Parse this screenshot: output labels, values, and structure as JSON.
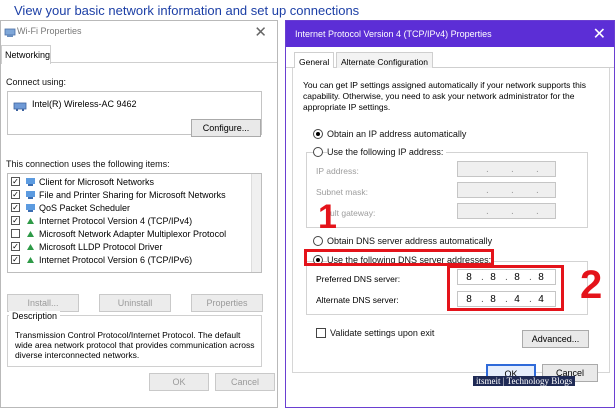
{
  "header": {
    "text": "View your basic network information and set up connections"
  },
  "wifi_window": {
    "title": "Wi-Fi Properties",
    "tab": "Networking",
    "connect_using_label": "Connect using:",
    "adapter_name": "Intel(R) Wireless-AC 9462",
    "configure_button": "Configure...",
    "items_label": "This connection uses the following items:",
    "items": [
      {
        "label": "Client for Microsoft Networks",
        "checked": true,
        "icon": "network-client-icon"
      },
      {
        "label": "File and Printer Sharing for Microsoft Networks",
        "checked": true,
        "icon": "file-printer-sharing-icon"
      },
      {
        "label": "QoS Packet Scheduler",
        "checked": true,
        "icon": "qos-scheduler-icon"
      },
      {
        "label": "Internet Protocol Version 4 (TCP/IPv4)",
        "checked": true,
        "icon": "protocol-icon"
      },
      {
        "label": "Microsoft Network Adapter Multiplexor Protocol",
        "checked": false,
        "icon": "protocol-icon"
      },
      {
        "label": "Microsoft LLDP Protocol Driver",
        "checked": true,
        "icon": "protocol-icon"
      },
      {
        "label": "Internet Protocol Version 6 (TCP/IPv6)",
        "checked": true,
        "icon": "protocol-icon"
      }
    ],
    "install_button": "Install...",
    "uninstall_button": "Uninstall",
    "properties_button": "Properties",
    "description_legend": "Description",
    "description_text": "Transmission Control Protocol/Internet Protocol. The default wide area network protocol that provides communication across diverse interconnected networks.",
    "ok_button": "OK",
    "cancel_button": "Cancel"
  },
  "ipv4_window": {
    "title": "Internet Protocol Version 4 (TCP/IPv4) Properties",
    "titlebar_color": "#5c2ed6",
    "tabs": [
      "General",
      "Alternate Configuration"
    ],
    "intro": "You can get IP settings assigned automatically if your network supports this capability. Otherwise, you need to ask your network administrator for the appropriate IP settings.",
    "obtain_ip_auto": "Obtain an IP address automatically",
    "use_following_ip": "Use the following IP address:",
    "ip_address_label": "IP address:",
    "subnet_mask_label": "Subnet mask:",
    "default_gateway_label": "Default gateway:",
    "default_gateway_visible": "ult gateway:",
    "obtain_dns_auto": "Obtain DNS server address automatically",
    "use_following_dns": "Use the following DNS server addresses:",
    "preferred_dns_label": "Preferred DNS server:",
    "preferred_dns": [
      "8",
      "8",
      "8",
      "8"
    ],
    "alternate_dns_label": "Alternate DNS server:",
    "alternate_dns": [
      "8",
      "8",
      "4",
      "4"
    ],
    "validate_label": "Validate settings upon exit",
    "advanced_button": "Advanced...",
    "ok_button": "OK",
    "cancel_button": "Cancel",
    "selected_ip_option": "automatic",
    "selected_dns_option": "manual"
  },
  "annotations": {
    "step1": "1",
    "step2": "2",
    "highlight_color": "#e4131a"
  },
  "watermark": "itsmeit | Technology Blogs"
}
